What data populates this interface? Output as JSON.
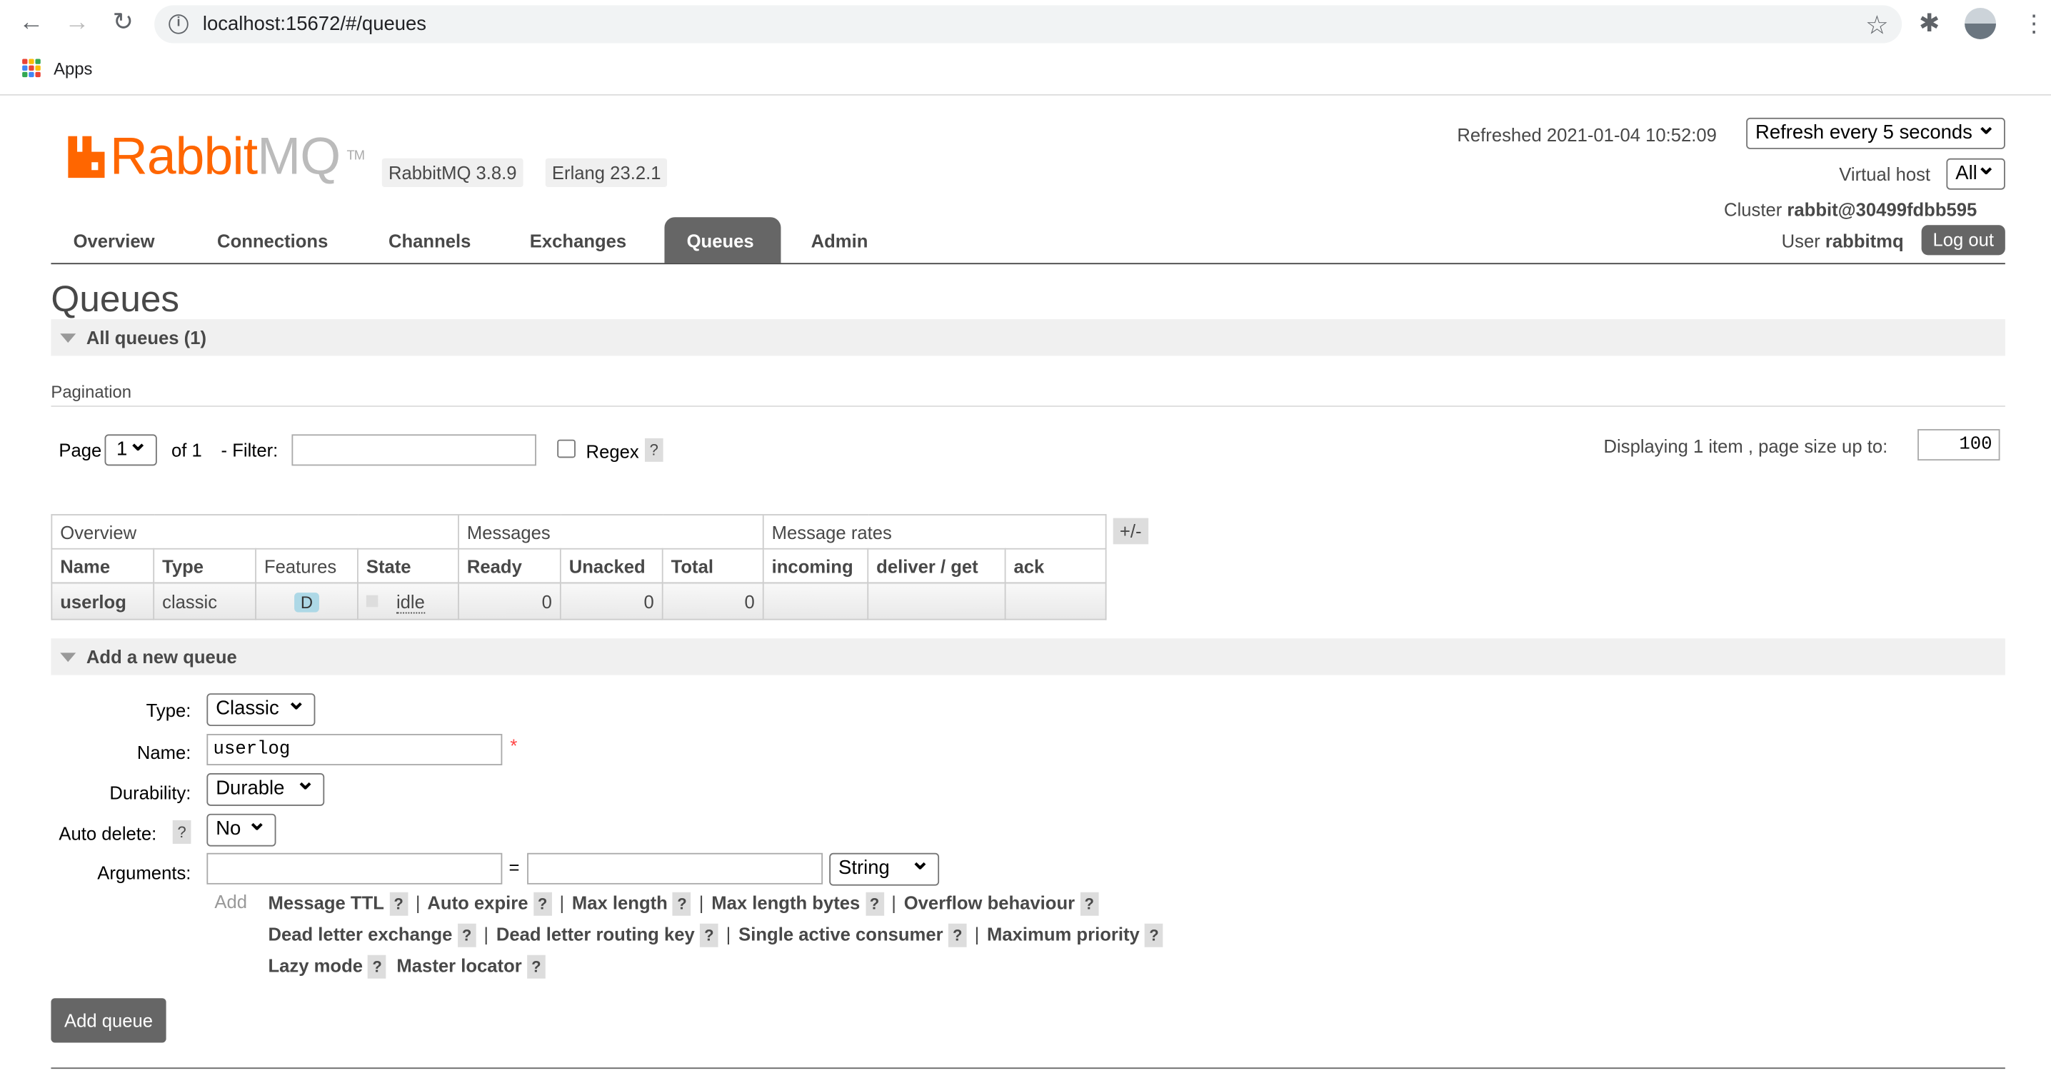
{
  "browser": {
    "url": "localhost:15672/#/queues",
    "bookmarks_apps": "Apps"
  },
  "header": {
    "logo_text": "Rabbit",
    "logo_mq": "MQ",
    "logo_tm": "TM",
    "rabbitmq_version": "RabbitMQ 3.8.9",
    "erlang_version": "Erlang 23.2.1",
    "refreshed_label": "Refreshed 2021-01-04 10:52:09",
    "refresh_select": "Refresh every 5 seconds",
    "vhost_label": "Virtual host",
    "vhost_value": "All",
    "cluster_label": "Cluster",
    "cluster_value": "rabbit@30499fdbb595",
    "user_label": "User",
    "user_value": "rabbitmq",
    "logout": "Log out"
  },
  "tabs": [
    "Overview",
    "Connections",
    "Channels",
    "Exchanges",
    "Queues",
    "Admin"
  ],
  "active_tab": "Queues",
  "page_title": "Queues",
  "all_queues": {
    "title": "All queues (1)",
    "pagination_label": "Pagination",
    "page_label": "Page",
    "page_value": "1",
    "of_label": "of 1",
    "filter_label": "- Filter:",
    "filter_value": "",
    "regex_label": "Regex",
    "help": "?",
    "display_label": "Displaying 1 item , page size up to:",
    "page_size": "100"
  },
  "queue_table": {
    "groups": [
      "Overview",
      "Messages",
      "Message rates"
    ],
    "columns": [
      "Name",
      "Type",
      "Features",
      "State",
      "Ready",
      "Unacked",
      "Total",
      "incoming",
      "deliver / get",
      "ack"
    ],
    "plusminus": "+/-",
    "rows": [
      {
        "name": "userlog",
        "type": "classic",
        "features": "D",
        "state": "idle",
        "ready": "0",
        "unacked": "0",
        "total": "0",
        "incoming": "",
        "deliver_get": "",
        "ack": ""
      }
    ]
  },
  "add_queue": {
    "title": "Add a new queue",
    "type_label": "Type:",
    "type_value": "Classic",
    "name_label": "Name:",
    "name_value": "userlog",
    "required_mark": "*",
    "durability_label": "Durability:",
    "durability_value": "Durable",
    "auto_delete_label": "Auto delete:",
    "auto_delete_value": "No",
    "arguments_label": "Arguments:",
    "equals": "=",
    "arg_type": "String",
    "add_label": "Add",
    "arg_links_row1": [
      "Message TTL",
      "Auto expire",
      "Max length",
      "Max length bytes",
      "Overflow behaviour"
    ],
    "arg_links_row2": [
      "Dead letter exchange",
      "Dead letter routing key",
      "Single active consumer",
      "Maximum priority"
    ],
    "arg_links_row3": [
      "Lazy mode",
      "Master locator"
    ],
    "submit": "Add queue"
  },
  "colors": {
    "brand": "#ff6600",
    "tab_active": "#666666",
    "feature_badge": "#add8e6"
  }
}
